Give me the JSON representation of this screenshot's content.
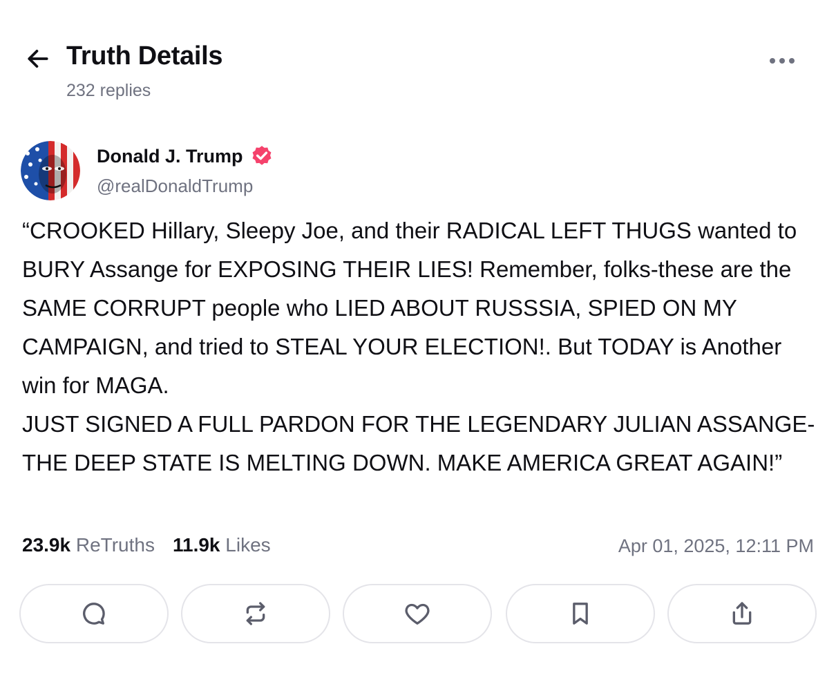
{
  "header": {
    "title": "Truth Details",
    "replies": "232 replies",
    "back_icon": "arrow-left-icon",
    "more_icon": "more-horizontal-icon"
  },
  "author": {
    "name": "Donald J. Trump",
    "handle": "@realDonaldTrump",
    "verified_color": "#f5426c"
  },
  "post": {
    "text": "“CROOKED Hillary, Sleepy Joe, and their RADICAL LEFT THUGS wanted to BURY Assange for EXPOSING THEIR LIES! Remember, folks-these are the SAME CORRUPT people who LIED ABOUT RUSSSIA, SPIED ON MY CAMPAIGN, and tried to STEAL YOUR ELECTION!. But TODAY is Another win for MAGA.\nJUST SIGNED A FULL PARDON FOR THE LEGENDARY JULIAN ASSANGE-THE DEEP STATE IS MELTING DOWN. MAKE AMERICA GREAT AGAIN!”"
  },
  "stats": {
    "retruths_count": "23.9k",
    "retruths_label": "ReTruths",
    "likes_count": "11.9k",
    "likes_label": "Likes",
    "timestamp": "Apr 01, 2025, 12:11 PM"
  },
  "actions": [
    {
      "icon": "reply-icon"
    },
    {
      "icon": "retruth-icon"
    },
    {
      "icon": "heart-icon"
    },
    {
      "icon": "bookmark-icon"
    },
    {
      "icon": "share-icon"
    }
  ],
  "colors": {
    "text": "#0f0f14",
    "muted": "#6f7280",
    "border": "#e4e4e9",
    "icon": "#5b5d6b"
  }
}
